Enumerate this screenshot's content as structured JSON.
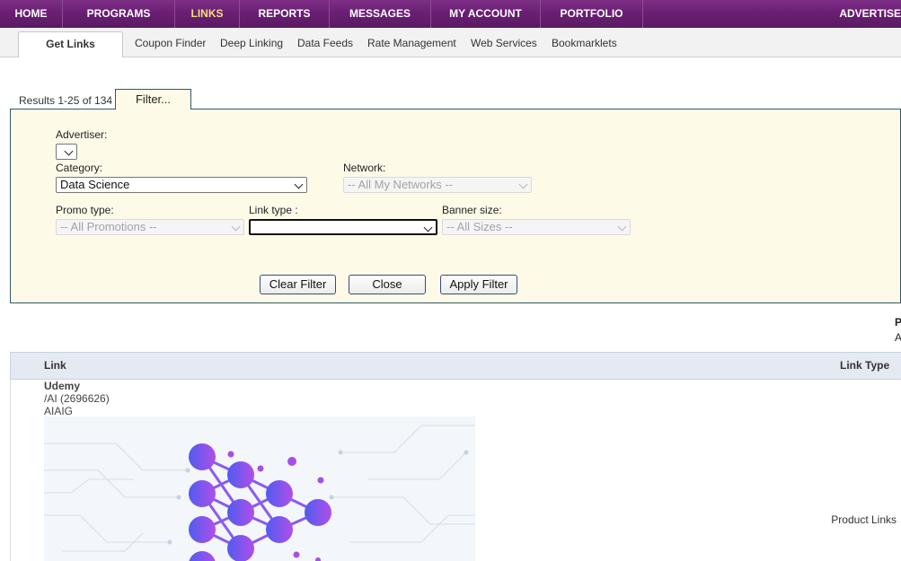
{
  "topnav": {
    "items": [
      "HOME",
      "PROGRAMS",
      "LINKS",
      "REPORTS",
      "MESSAGES",
      "MY ACCOUNT",
      "PORTFOLIO"
    ],
    "active": "LINKS",
    "right_label": "ADVERTISE"
  },
  "subnav": {
    "tabs": [
      "Get Links",
      "Coupon Finder",
      "Deep Linking",
      "Data Feeds",
      "Rate Management",
      "Web Services",
      "Bookmarklets"
    ],
    "active": "Get Links"
  },
  "results_text": "Results 1-25 of 134",
  "filter_tab_label": "Filter...",
  "filter": {
    "advertiser_label": "Advertiser:",
    "advertiser_value": "",
    "category_label": "Category:",
    "category_value": "Data Science",
    "network_label": "Network:",
    "network_value": "-- All My Networks --",
    "promo_label": "Promo type:",
    "promo_value": "-- All Promotions --",
    "linktype_label": "Link type :",
    "linktype_value": "",
    "banner_label": "Banner size:",
    "banner_value": "-- All Sizes --",
    "clear_button": "Clear Filter",
    "close_button": "Close",
    "apply_button": "Apply Filter"
  },
  "cutoff": {
    "line1": "P",
    "line2": "A"
  },
  "table": {
    "col_link": "Link",
    "col_link_type": "Link Type",
    "row": {
      "advertiser": "Udemy",
      "link_name": "/AI (2696626)",
      "link_code": "AIAIG",
      "link_type": "Product Links"
    }
  },
  "colors": {
    "nav_purple": "#6a1f74",
    "nav_active_text": "#f5e07a",
    "filter_bg": "#fdfbe8",
    "filter_border": "#2f5a66",
    "table_header_bg": "#e4e9f2"
  }
}
